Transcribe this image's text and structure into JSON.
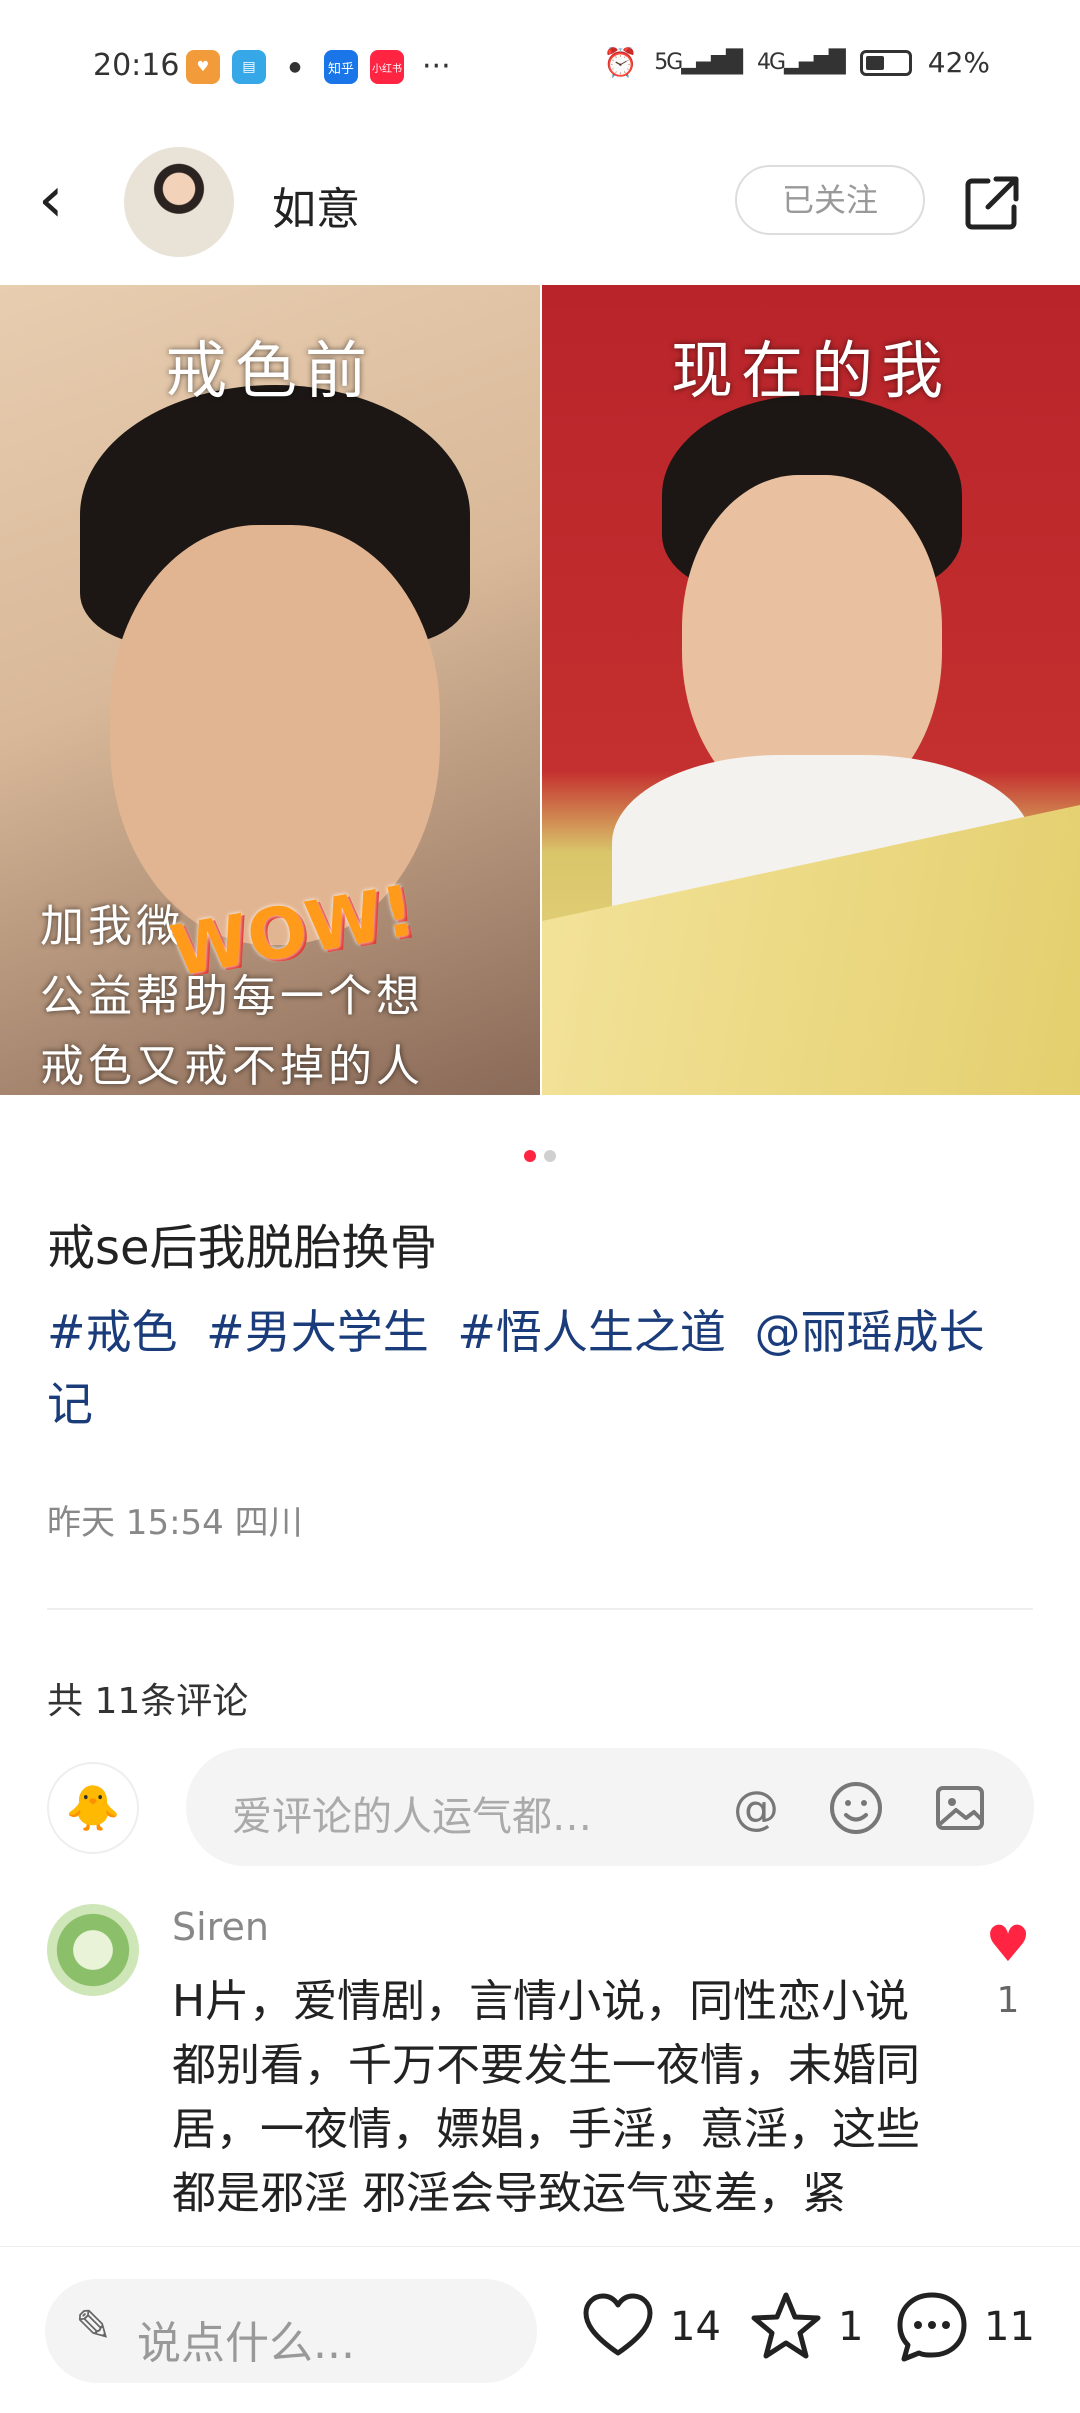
{
  "status_bar": {
    "time": "20:16",
    "apps": [
      {
        "name": "wallet-app-icon",
        "color": "#f29b3a",
        "glyph": "♥"
      },
      {
        "name": "book-app-icon",
        "color": "#36a8e8",
        "glyph": "▤"
      },
      {
        "name": "qq-app-icon",
        "color": "#333333",
        "glyph": "●"
      },
      {
        "name": "zhihu-app-icon",
        "color": "#1a75e8",
        "glyph": "知乎"
      },
      {
        "name": "xiaohongshu-app-icon",
        "color": "#ff2442",
        "glyph": "小红书"
      }
    ],
    "more": "···",
    "signal_5g": "5G",
    "signal_4g": "4G",
    "battery": "42%"
  },
  "header": {
    "username": "如意",
    "follow_label": "已关注"
  },
  "hero": {
    "left_caption": "戒色前",
    "right_caption": "现在的我",
    "overlay_lines": [
      "加我微",
      "公益帮助每一个想",
      "戒色又戒不掉的人"
    ],
    "sticker": "WOW!",
    "pages": 2,
    "active_page": 1
  },
  "post": {
    "title": "戒se后我脱胎换骨",
    "tags": [
      "#戒色",
      "#男大学生",
      "#悟人生之道",
      "@丽瑶成长记"
    ],
    "meta": "昨天 15:54 四川"
  },
  "comments_section": {
    "count_label": "共 11条评论",
    "input_placeholder": "爱评论的人运气都…",
    "my_avatar_icon": "🐥"
  },
  "comments": [
    {
      "user": "Siren",
      "text": "H片，爱情剧，言情小说，同性恋小说都别看，千万不要发生一夜情，未婚同居，一夜情，嫖娼，手淫，意淫，这些都是邪淫 邪淫会导致运气变差，紧点，身体",
      "likes": "1"
    }
  ],
  "bottom_bar": {
    "say_placeholder": "说点什么...",
    "likes": "14",
    "favorites": "1",
    "comments": "11"
  },
  "colors": {
    "accent": "#ff2442",
    "tag": "#1a3c7a"
  }
}
